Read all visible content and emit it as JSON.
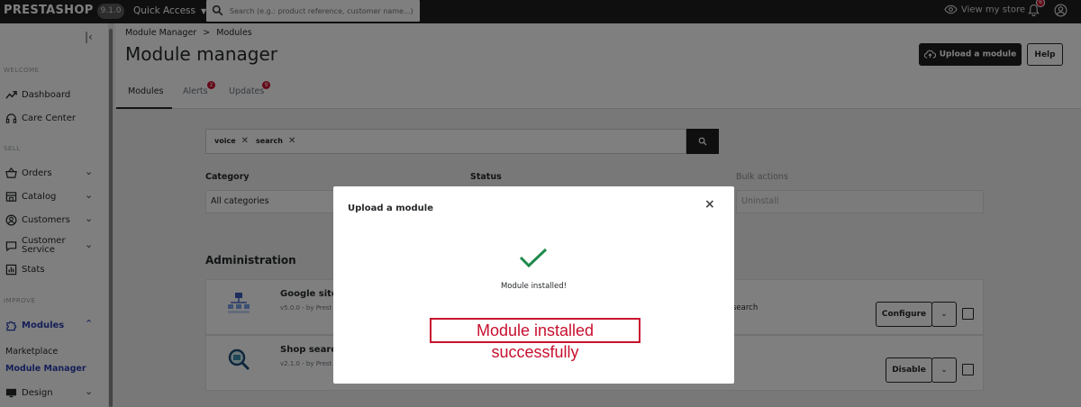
{
  "topbar": {
    "logo": "PRESTASHOP",
    "version": "9.1.0",
    "quick_access": "Quick Access",
    "search_placeholder": "Search (e.g.: product reference, customer name...)",
    "view_store": "View my store",
    "notifications_count": "6"
  },
  "sidebar": {
    "sections": {
      "welcome": "WELCOME",
      "sell": "SELL",
      "improve": "IMPROVE"
    },
    "items": {
      "dashboard": "Dashboard",
      "care_center": "Care Center",
      "orders": "Orders",
      "catalog": "Catalog",
      "customers": "Customers",
      "customer_service_1": "Customer",
      "customer_service_2": "Service",
      "stats": "Stats",
      "modules": "Modules",
      "marketplace": "Marketplace",
      "module_manager": "Module Manager",
      "design": "Design"
    }
  },
  "header": {
    "breadcrumb_parent": "Module Manager",
    "breadcrumb_sep": ">",
    "breadcrumb_current": "Modules",
    "title": "Module manager",
    "upload_button": "Upload a module",
    "help_button": "Help",
    "tabs": [
      {
        "label": "Modules",
        "badge": ""
      },
      {
        "label": "Alerts",
        "badge": "2"
      },
      {
        "label": "Updates",
        "badge": "9"
      }
    ]
  },
  "filters": {
    "chips": [
      "voice",
      "search"
    ],
    "category_label": "Category",
    "category_value": "All categories",
    "status_label": "Status",
    "bulk_label": "Bulk actions",
    "bulk_value": "Uninstall"
  },
  "section_title": "Administration",
  "modules": [
    {
      "name": "Google siter",
      "version": "v5.0.0 - by Prest",
      "description": "search",
      "action": "Configure"
    },
    {
      "name": "Shop search",
      "version": "v2.1.0 - by Prest",
      "description": "",
      "action": "Disable"
    }
  ],
  "modal": {
    "title": "Upload a module",
    "close": "×",
    "status": "Module installed!",
    "success_annotation": "Module installed successfully"
  },
  "colors": {
    "accent": "#2a3eb1",
    "dark": "#1e1e1e",
    "success": "#1f8a4c",
    "danger": "#c8102e"
  }
}
